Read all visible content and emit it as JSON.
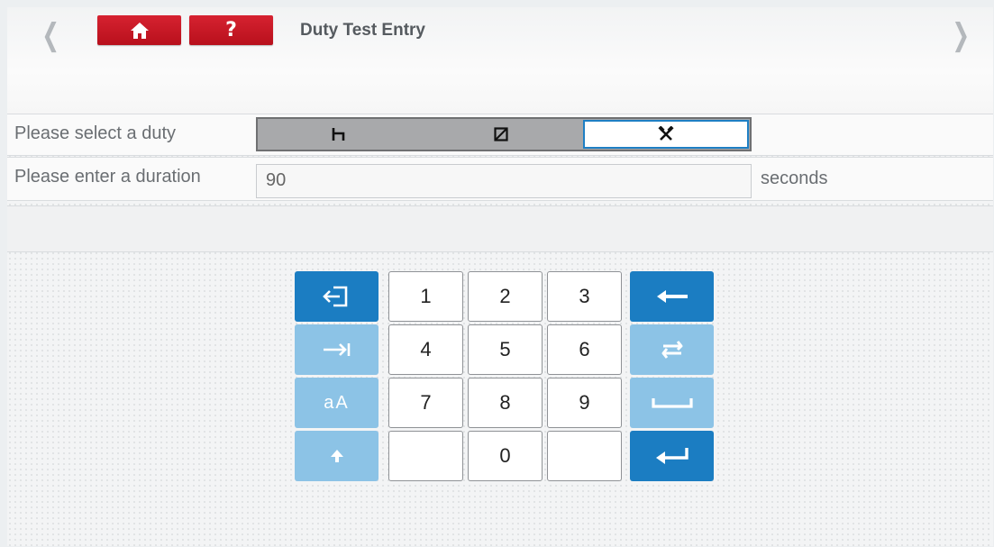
{
  "header": {
    "title": "Duty Test Entry",
    "help_label": "?"
  },
  "form": {
    "duty_label": "Please select a duty",
    "duty_options": [
      {
        "icon": "rest-icon",
        "glyph": "h",
        "selected": false
      },
      {
        "icon": "availability-icon",
        "glyph": "⊠",
        "selected": false
      },
      {
        "icon": "work-icon",
        "glyph": "⚒",
        "selected": true
      }
    ],
    "duration_label": "Please enter a duration",
    "duration_value": "90",
    "duration_unit": "seconds"
  },
  "keypad": {
    "digits": [
      "1",
      "2",
      "3",
      "4",
      "5",
      "6",
      "7",
      "8",
      "9",
      "",
      "0",
      ""
    ],
    "left_keys": [
      {
        "name": "exit-keyboard-key",
        "icon": "exit-icon",
        "style": "dark"
      },
      {
        "name": "tab-key",
        "icon": "tab-icon",
        "style": "light"
      },
      {
        "name": "case-toggle-key",
        "label": "aA",
        "style": "light"
      },
      {
        "name": "shift-key",
        "icon": "arrow-up-icon",
        "style": "light"
      }
    ],
    "right_keys": [
      {
        "name": "backspace-key",
        "icon": "arrow-left-icon",
        "style": "dark"
      },
      {
        "name": "swap-key",
        "icon": "swap-icon",
        "style": "light"
      },
      {
        "name": "space-key",
        "icon": "space-icon",
        "style": "light"
      },
      {
        "name": "enter-key",
        "icon": "enter-icon",
        "style": "dark"
      }
    ],
    "case_label": "aA"
  },
  "colors": {
    "accent_red": "#c8161f",
    "key_dark_blue": "#1b7dc2",
    "key_light_blue": "#8cc3e6"
  }
}
